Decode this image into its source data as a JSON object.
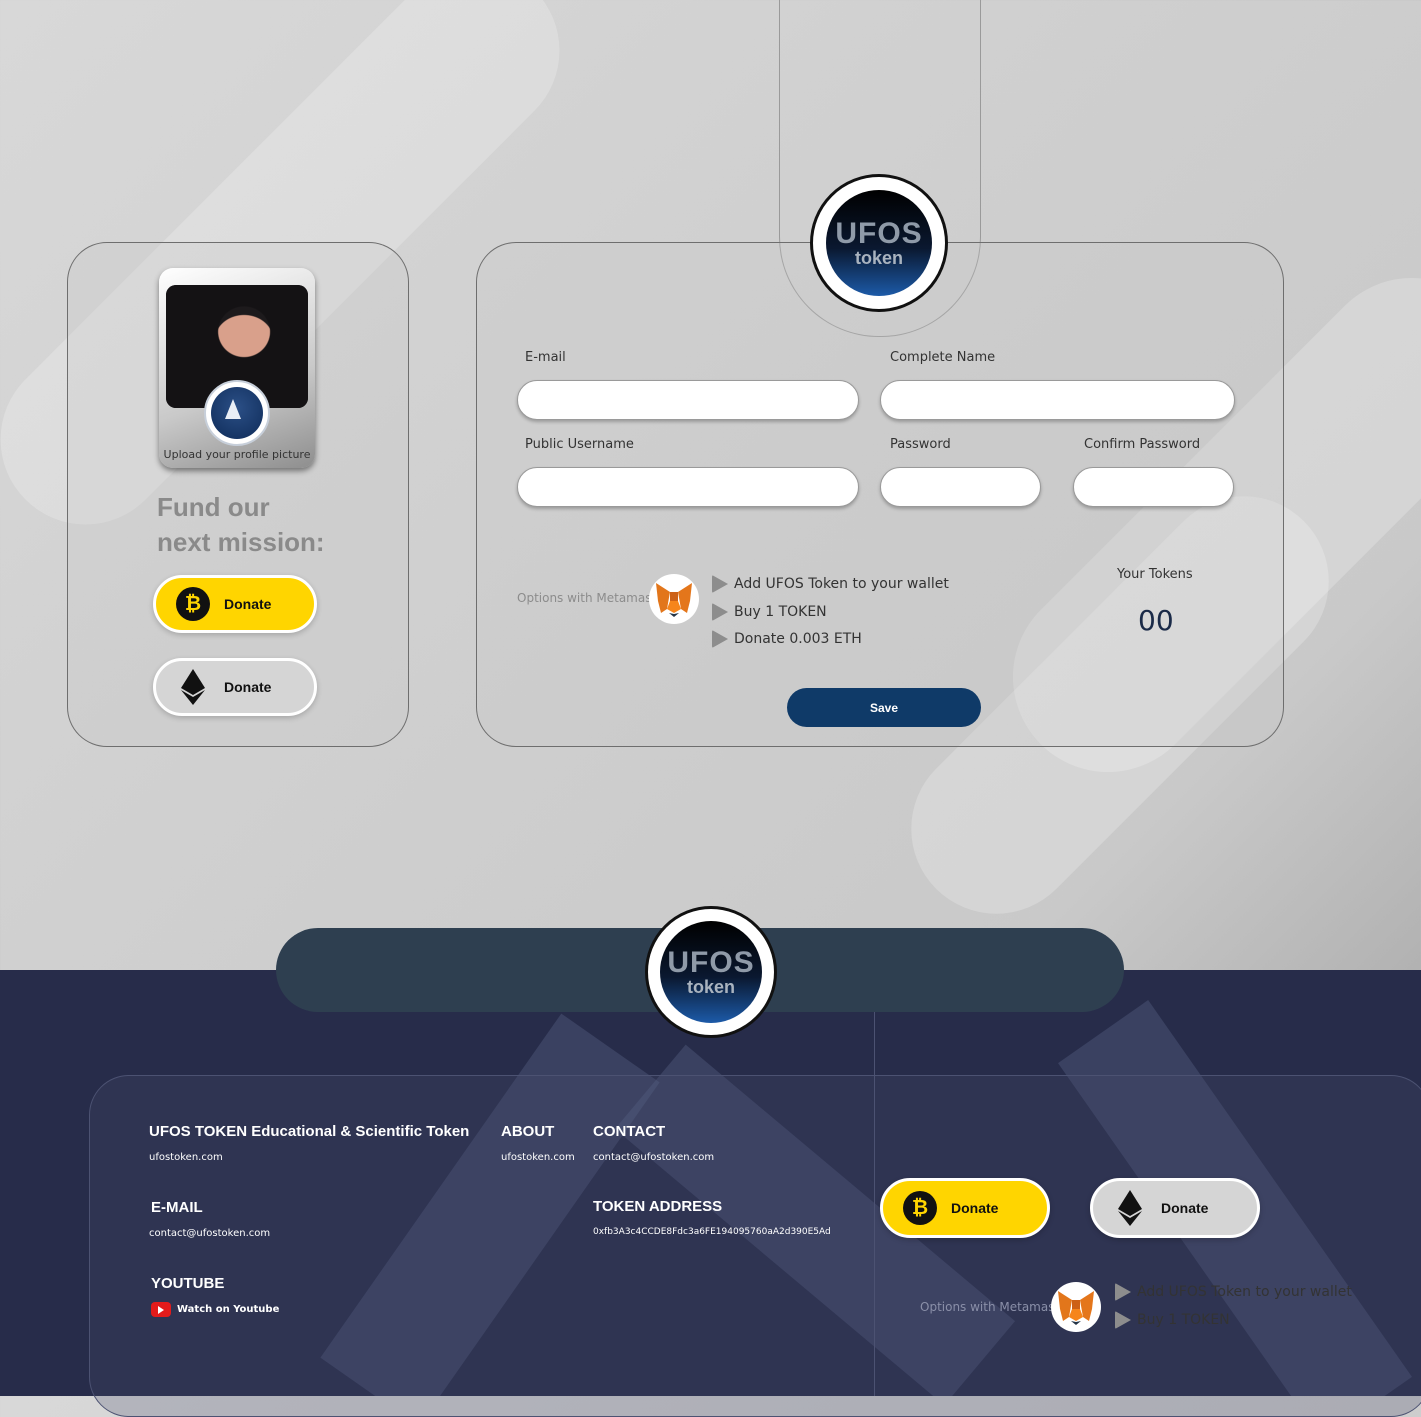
{
  "profile": {
    "upload_label": "Upload your profile picture",
    "fund_title_line1": "Fund our",
    "fund_title_line2": "next mission:",
    "donate_btc_label": "Donate",
    "donate_eth_label": "Donate"
  },
  "logo": {
    "line1": "UFOS",
    "line2": "token"
  },
  "form": {
    "email_label": "E-mail",
    "name_label": "Complete Name",
    "username_label": "Public Username",
    "password_label": "Password",
    "confirm_label": "Confirm Password",
    "email_value": "",
    "name_value": "",
    "username_value": "",
    "password_value": "",
    "confirm_value": ""
  },
  "metamask": {
    "options_label": "Options with Metamask",
    "items": [
      "Add UFOS Token to your wallet",
      "Buy 1 TOKEN",
      "Donate 0.003 ETH"
    ]
  },
  "tokens": {
    "label": "Your Tokens",
    "value": "00"
  },
  "save_label": "Save",
  "footer": {
    "col1_title": "UFOS TOKEN Educational & Scientific Token",
    "col1_link": "ufostoken.com",
    "about_title": "ABOUT",
    "about_link": "ufostoken.com",
    "contact_title": "CONTACT",
    "contact_link": "contact@ufostoken.com",
    "email_title": "E-MAIL",
    "email_link": "contact@ufostoken.com",
    "token_title": "TOKEN ADDRESS",
    "token_address": "0xfb3A3c4CCDE8Fdc3a6FE194095760aA2d390E5Ad",
    "youtube_title": "YOUTUBE",
    "youtube_link": "Watch on Youtube",
    "donate_btc_label": "Donate",
    "donate_eth_label": "Donate",
    "mm_options_label": "Options with Metamask",
    "mm_items": [
      "Add UFOS Token to your wallet",
      "Buy 1 TOKEN"
    ]
  },
  "colors": {
    "btc_yellow": "#ffd500",
    "save_blue": "#0f3a68",
    "footer_bg": "#272c4a"
  }
}
